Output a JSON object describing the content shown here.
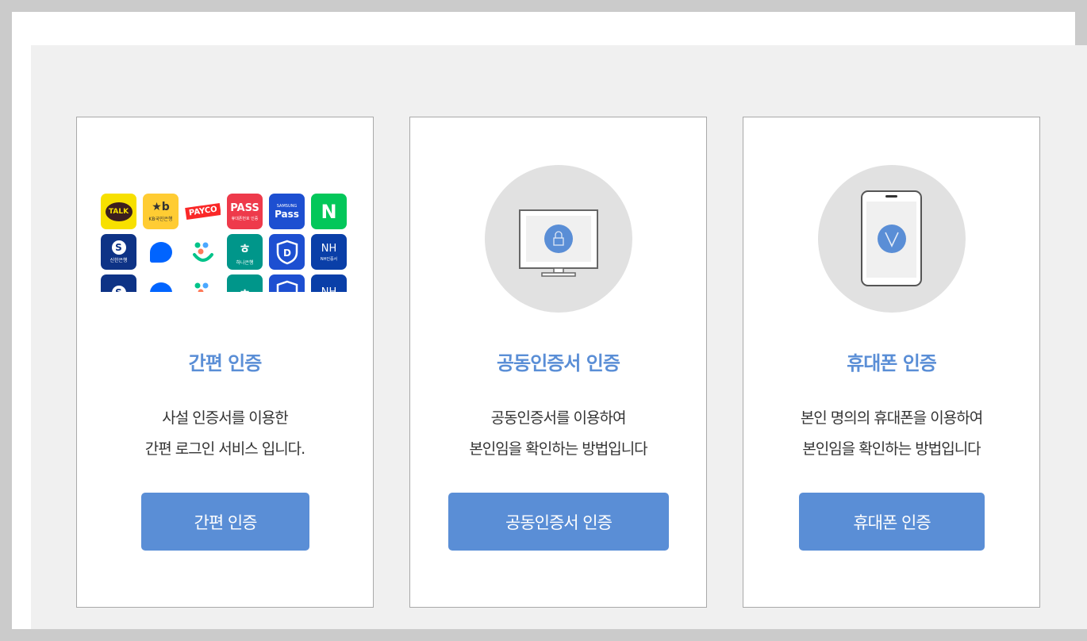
{
  "cards": [
    {
      "title": "간편 인증",
      "desc_line1": "사설 인증서를 이용한",
      "desc_line2": "간편 로그인 서비스 입니다.",
      "button": "간편 인증",
      "icon": "app-logos"
    },
    {
      "title": "공동인증서 인증",
      "desc_line1": "공동인증서를 이용하여",
      "desc_line2": "본인임을 확인하는 방법입니다",
      "button": "공동인증서 인증",
      "icon": "monitor-lock-icon"
    },
    {
      "title": "휴대폰 인증",
      "desc_line1": "본인 명의의 휴대폰을 이용하여",
      "desc_line2": "본인임을 확인하는 방법입니다",
      "button": "휴대폰 인증",
      "icon": "phone-check-icon"
    }
  ],
  "apps": {
    "kakao": "TALK",
    "kb_logo": "★b",
    "kb_name": "KB국민은행",
    "payco": "PAYCO",
    "pass": "PASS",
    "pass_sub": "휴대폰번호 인증",
    "samsung_top": "SAMSUNG",
    "samsung": "Pass",
    "naver": "N",
    "shinhan": "신한은행",
    "hana": "하나은행",
    "nh": "NH",
    "nh_sub": "NH인증서"
  },
  "colors": {
    "accent": "#5a8ed6",
    "panel_bg": "#f0f0f0",
    "circle_bg": "#e1e1e1"
  }
}
